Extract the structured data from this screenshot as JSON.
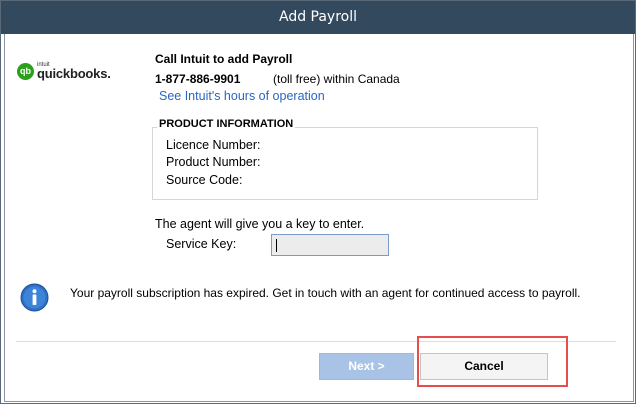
{
  "window": {
    "title": "Add Payroll"
  },
  "logo": {
    "mark": "qb",
    "small_text": "intuit",
    "brand": "quickbooks."
  },
  "contact": {
    "heading": "Call Intuit to add Payroll",
    "phone": "1-877-886-9901",
    "phone_note": "(toll free) within Canada",
    "hours_link": "See Intuit's hours of operation"
  },
  "product_info": {
    "title": "PRODUCT INFORMATION",
    "licence_label": "Licence Number:",
    "product_label": "Product Number:",
    "source_label": "Source Code:"
  },
  "service_key": {
    "instruction": "The agent will give you a key to enter.",
    "label": "Service Key:",
    "value": ""
  },
  "info": {
    "icon": "info-icon",
    "message": "Your payroll subscription has expired. Get in touch with an agent for continued access to payroll."
  },
  "buttons": {
    "next_label": "Next >",
    "cancel_label": "Cancel"
  },
  "colors": {
    "titlebar": "#33495e",
    "link": "#2a64c4",
    "next_disabled": "#a9c3e6",
    "highlight": "#e84c4c"
  }
}
